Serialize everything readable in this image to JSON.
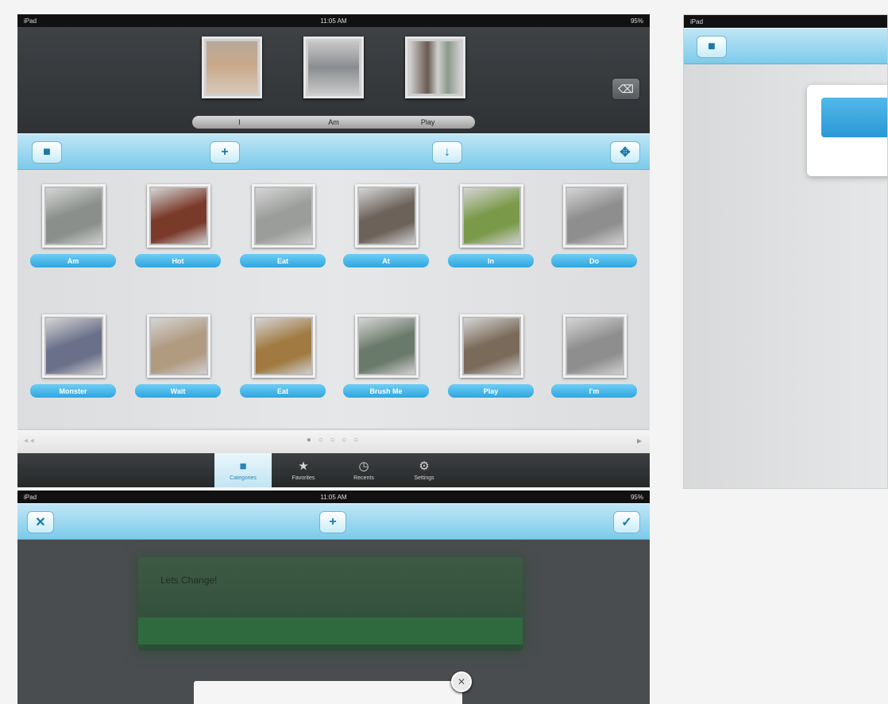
{
  "status": {
    "carrier": "iPad",
    "time": "11:05 AM",
    "battery": "95%"
  },
  "sentence_strip": {
    "words": [
      "I",
      "Am",
      "Play"
    ]
  },
  "toolbar": {
    "home_icon": "home-icon",
    "add_label": "+",
    "download_label": "↓",
    "move_label": "✥"
  },
  "grid": {
    "rows": [
      [
        {
          "label": "Am",
          "color": "#8a8f8b"
        },
        {
          "label": "Hot",
          "color": "#7a3a2a"
        },
        {
          "label": "Eat",
          "color": "#9a9d9a"
        },
        {
          "label": "At",
          "color": "#6c625a"
        },
        {
          "label": "In",
          "color": "#7a9a4a"
        },
        {
          "label": "Do",
          "color": "#8e8e8e"
        }
      ],
      [
        {
          "label": "Monster",
          "color": "#6a6f8a"
        },
        {
          "label": "Wait",
          "color": "#b09a80"
        },
        {
          "label": "Eat",
          "color": "#a07a40"
        },
        {
          "label": "Brush Me",
          "color": "#6a7a6a"
        },
        {
          "label": "Play",
          "color": "#7a6a5a"
        },
        {
          "label": "I'm",
          "color": "#8e8e8e"
        }
      ]
    ]
  },
  "pager": {
    "prev": "◂ ◂",
    "dots": "● ○ ○ ○ ○",
    "next": "▸"
  },
  "tabs": [
    {
      "label": "Categories",
      "icon": "categories-icon",
      "active": true
    },
    {
      "label": "Favorites",
      "icon": "star-icon",
      "active": false
    },
    {
      "label": "Recents",
      "icon": "clock-icon",
      "active": false
    },
    {
      "label": "Settings",
      "icon": "gear-icon",
      "active": false
    }
  ],
  "editor": {
    "cancel_label": "✕",
    "add_label": "+",
    "confirm_label": "✓",
    "board_title": "Lets Change!"
  },
  "dialog": {
    "close_label": "✕"
  }
}
